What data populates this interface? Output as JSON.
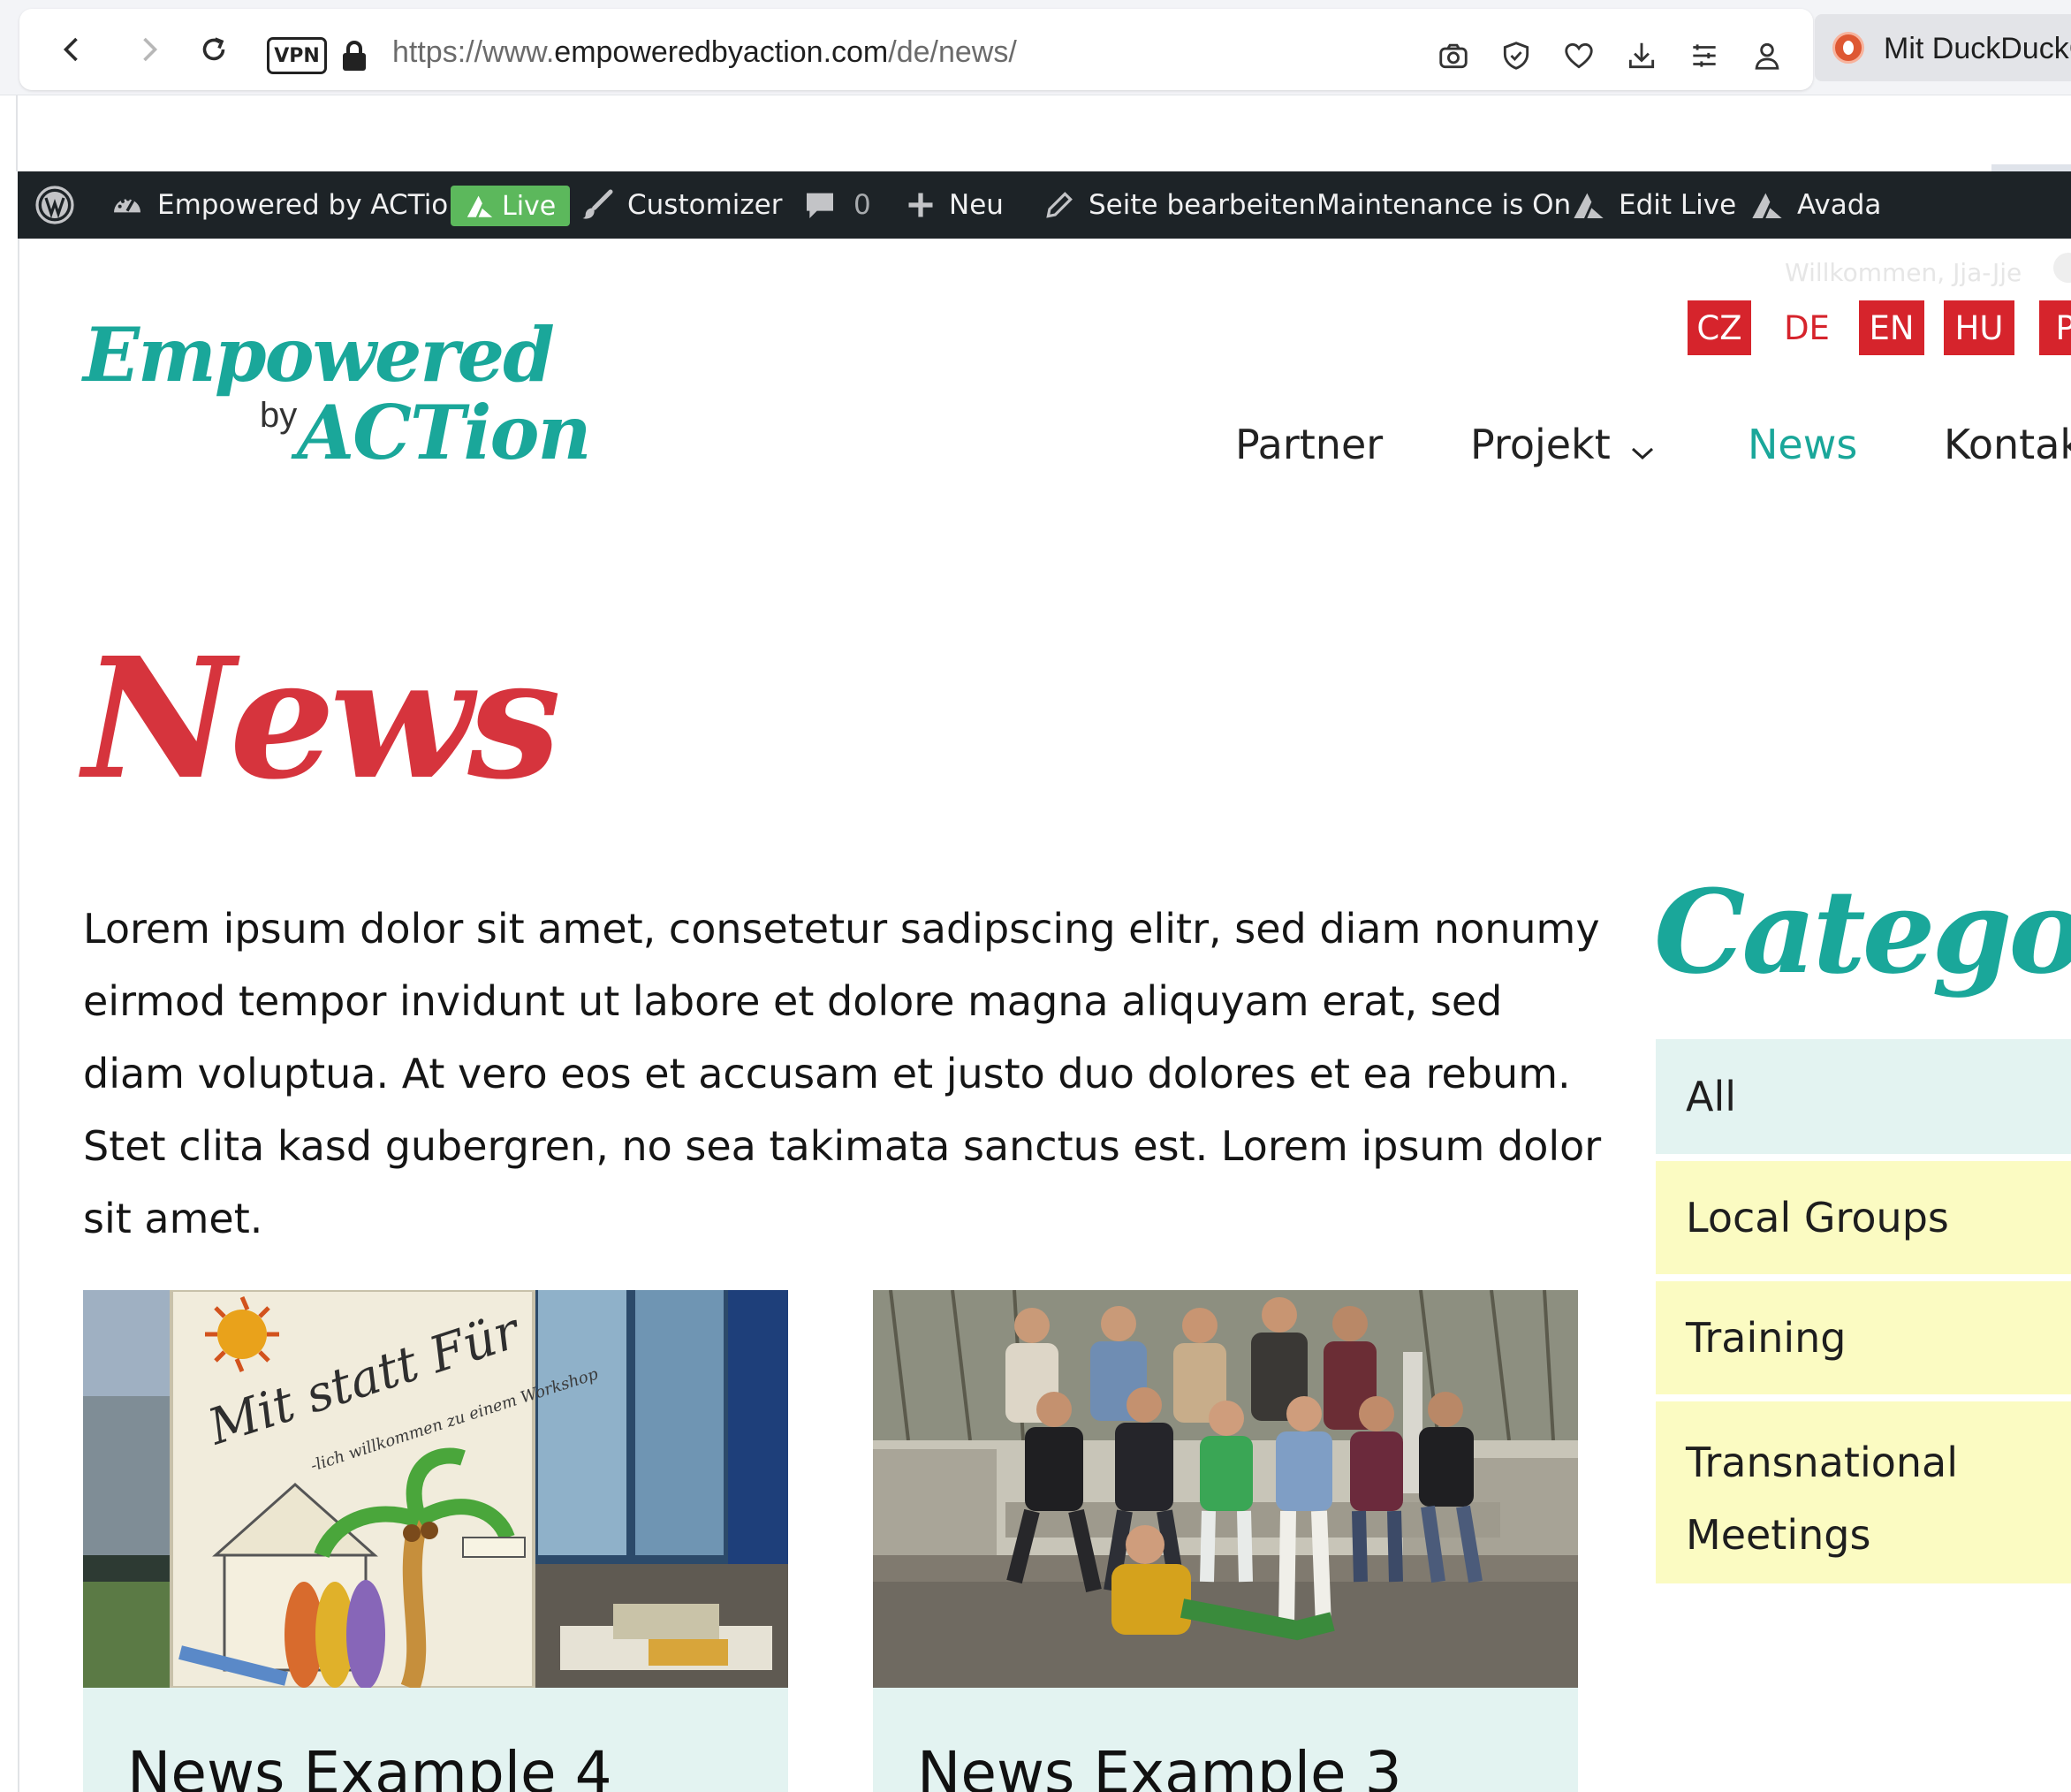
{
  "browser": {
    "url_scheme": "https://www.",
    "url_host": "empoweredbyaction.com",
    "url_path": "/de/news/",
    "vpn_label": "VPN",
    "search_tab_label": "Mit DuckDuckG",
    "icons": [
      "back-icon",
      "forward-icon",
      "reload-icon",
      "lock-icon",
      "camera-icon",
      "shield-icon",
      "heart-icon",
      "download-icon",
      "menu-icon",
      "account-icon",
      "duckduckgo-icon"
    ]
  },
  "admin_bar": {
    "site_name": "Empowered by ACTion",
    "live_label": "Live",
    "customizer": "Customizer",
    "comments_count": "0",
    "new_label": "Neu",
    "edit_page": "Seite bearbeiten",
    "maintenance": "Maintenance is On",
    "edit_live": "Edit Live",
    "avada": "Avada",
    "welcome": "Willkommen, Jja-Jje"
  },
  "languages": [
    {
      "code": "CZ",
      "current": false
    },
    {
      "code": "DE",
      "current": true
    },
    {
      "code": "EN",
      "current": false
    },
    {
      "code": "HU",
      "current": false
    },
    {
      "code": "PL",
      "current": false
    }
  ],
  "logo": {
    "line1": "Empowered",
    "by": "by",
    "line2": "ACTion"
  },
  "nav": {
    "items": [
      {
        "label": "Partner",
        "active": false
      },
      {
        "label": "Projekt",
        "active": false,
        "has_dropdown": true
      },
      {
        "label": "News",
        "active": true
      },
      {
        "label": "Kontakt",
        "active": false
      }
    ]
  },
  "page": {
    "title": "News",
    "intro": "Lorem ipsum dolor sit amet, consetetur sadipscing elitr, sed diam nonumy eirmod tempor invidunt ut labore et dolore magna aliquyam erat, sed diam voluptua. At vero eos et accusam et justo duo dolores et ea rebum. Stet clita kasd gubergren, no sea takimata sanctus est. Lorem ipsum dolor sit amet."
  },
  "cards": [
    {
      "title": "News Example 4",
      "image": "workshop-poster-photo"
    },
    {
      "title": "News Example 3",
      "image": "group-photo"
    }
  ],
  "poster": {
    "line1": "Mit statt Für",
    "line2": "-lich willkommen zu einem Workshop"
  },
  "sidebar": {
    "title": "Categories",
    "categories": [
      {
        "label": "All",
        "style": "all"
      },
      {
        "label": "Local Groups",
        "style": "yellow"
      },
      {
        "label": "Training",
        "style": "yellow"
      },
      {
        "label": "Transnational Meetings",
        "line1": "Transnational",
        "line2": "Meetings",
        "style": "yellow"
      }
    ]
  },
  "colors": {
    "teal": "#1aa79a",
    "red": "#d6343d",
    "flag_red": "#d6242c",
    "admin_bar": "#1d2327",
    "live_green": "#5cb85c",
    "card_bg": "#e3f3f1",
    "category_yellow": "#fbfbc2"
  }
}
